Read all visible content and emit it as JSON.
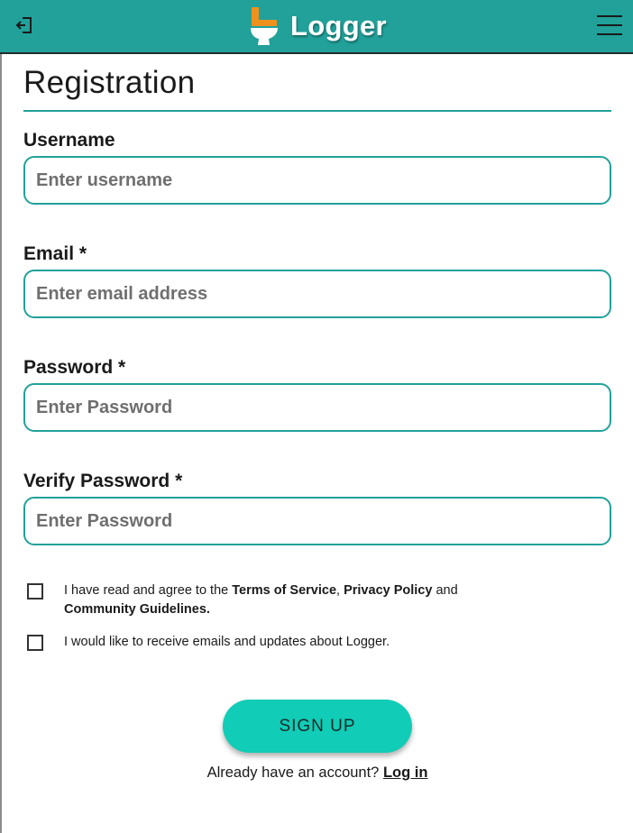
{
  "header": {
    "brand": "Logger",
    "exit_icon": "exit-icon",
    "menu_icon": "hamburger-menu-icon",
    "colors": {
      "bar": "#21a19a",
      "logo_orange": "#f0911e",
      "logo_white": "#ffffff"
    }
  },
  "page": {
    "title": "Registration"
  },
  "form": {
    "username": {
      "label": "Username",
      "placeholder": "Enter username",
      "value": ""
    },
    "email": {
      "label": "Email *",
      "placeholder": "Enter email address",
      "value": ""
    },
    "password": {
      "label": "Password *",
      "placeholder": "Enter Password",
      "value": ""
    },
    "verify_password": {
      "label": "Verify Password *",
      "placeholder": "Enter Password",
      "value": ""
    }
  },
  "agreements": {
    "terms": {
      "checked": false,
      "text_1": "I have read and agree to the ",
      "terms_link": "Terms of Service",
      "sep": ", ",
      "privacy_link": "Privacy Policy",
      "and": " and ",
      "guidelines_link": "Community Guidelines",
      "end": "."
    },
    "updates": {
      "checked": false,
      "text": "I would like to receive emails and updates about Logger."
    }
  },
  "actions": {
    "signup_label": "SIGN UP",
    "login_prompt": "Already have an account? ",
    "login_link": "Log in",
    "accent_color": "#11ccb6"
  }
}
